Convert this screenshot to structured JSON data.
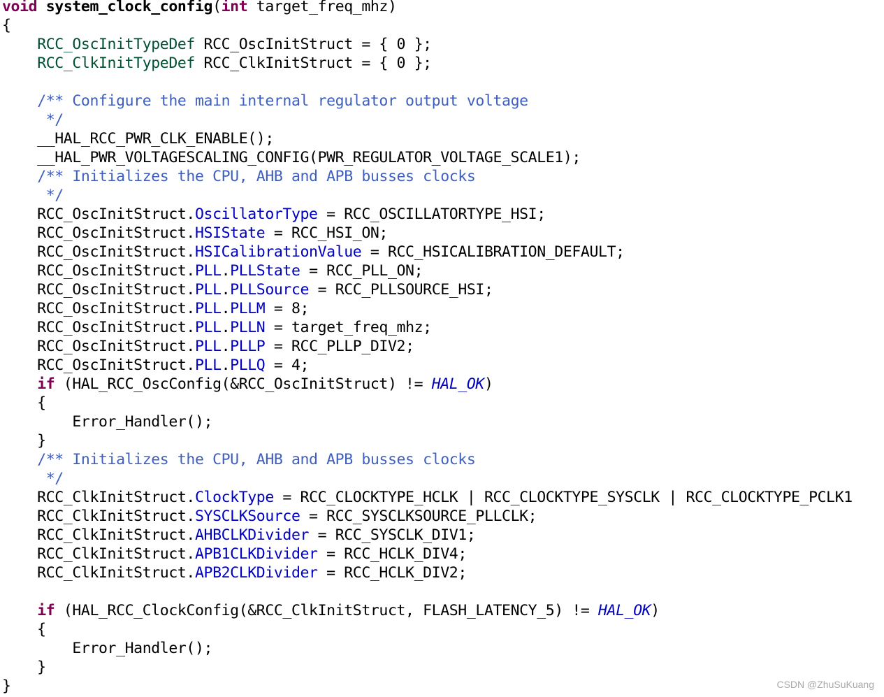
{
  "code": {
    "lines": [
      [
        {
          "t": "void",
          "c": "kw"
        },
        {
          "t": " "
        },
        {
          "t": "system_clock_config",
          "c": "fn"
        },
        {
          "t": "("
        },
        {
          "t": "int",
          "c": "kw"
        },
        {
          "t": " target_freq_mhz)"
        }
      ],
      [
        {
          "t": "{"
        }
      ],
      [
        {
          "t": "    "
        },
        {
          "t": "RCC_OscInitTypeDef",
          "c": "type"
        },
        {
          "t": " RCC_OscInitStruct = { 0 };"
        }
      ],
      [
        {
          "t": "    "
        },
        {
          "t": "RCC_ClkInitTypeDef",
          "c": "type"
        },
        {
          "t": " RCC_ClkInitStruct = { 0 };"
        }
      ],
      [
        {
          "t": ""
        }
      ],
      [
        {
          "t": "    "
        },
        {
          "t": "/** Configure the main internal regulator output voltage",
          "c": "cmt"
        }
      ],
      [
        {
          "t": "     "
        },
        {
          "t": "*/",
          "c": "cmt"
        }
      ],
      [
        {
          "t": "    __HAL_RCC_PWR_CLK_ENABLE();"
        }
      ],
      [
        {
          "t": "    __HAL_PWR_VOLTAGESCALING_CONFIG(PWR_REGULATOR_VOLTAGE_SCALE1);"
        }
      ],
      [
        {
          "t": "    "
        },
        {
          "t": "/** Initializes the CPU, AHB and APB busses clocks",
          "c": "cmt"
        }
      ],
      [
        {
          "t": "     "
        },
        {
          "t": "*/",
          "c": "cmt"
        }
      ],
      [
        {
          "t": "    RCC_OscInitStruct."
        },
        {
          "t": "OscillatorType",
          "c": "field"
        },
        {
          "t": " = RCC_OSCILLATORTYPE_HSI;"
        }
      ],
      [
        {
          "t": "    RCC_OscInitStruct."
        },
        {
          "t": "HSIState",
          "c": "field"
        },
        {
          "t": " = RCC_HSI_ON;"
        }
      ],
      [
        {
          "t": "    RCC_OscInitStruct."
        },
        {
          "t": "HSICalibrationValue",
          "c": "field"
        },
        {
          "t": " = RCC_HSICALIBRATION_DEFAULT;"
        }
      ],
      [
        {
          "t": "    RCC_OscInitStruct."
        },
        {
          "t": "PLL",
          "c": "field"
        },
        {
          "t": "."
        },
        {
          "t": "PLLState",
          "c": "field"
        },
        {
          "t": " = RCC_PLL_ON;"
        }
      ],
      [
        {
          "t": "    RCC_OscInitStruct."
        },
        {
          "t": "PLL",
          "c": "field"
        },
        {
          "t": "."
        },
        {
          "t": "PLLSource",
          "c": "field"
        },
        {
          "t": " = RCC_PLLSOURCE_HSI;"
        }
      ],
      [
        {
          "t": "    RCC_OscInitStruct."
        },
        {
          "t": "PLL",
          "c": "field"
        },
        {
          "t": "."
        },
        {
          "t": "PLLM",
          "c": "field"
        },
        {
          "t": " = 8;"
        }
      ],
      [
        {
          "t": "    RCC_OscInitStruct."
        },
        {
          "t": "PLL",
          "c": "field"
        },
        {
          "t": "."
        },
        {
          "t": "PLLN",
          "c": "field"
        },
        {
          "t": " = target_freq_mhz;"
        }
      ],
      [
        {
          "t": "    RCC_OscInitStruct."
        },
        {
          "t": "PLL",
          "c": "field"
        },
        {
          "t": "."
        },
        {
          "t": "PLLP",
          "c": "field"
        },
        {
          "t": " = RCC_PLLP_DIV2;"
        }
      ],
      [
        {
          "t": "    RCC_OscInitStruct."
        },
        {
          "t": "PLL",
          "c": "field"
        },
        {
          "t": "."
        },
        {
          "t": "PLLQ",
          "c": "field"
        },
        {
          "t": " = 4;"
        }
      ],
      [
        {
          "t": "    "
        },
        {
          "t": "if",
          "c": "kw"
        },
        {
          "t": " (HAL_RCC_OscConfig(&RCC_OscInitStruct) != "
        },
        {
          "t": "HAL_OK",
          "c": "const"
        },
        {
          "t": ")"
        }
      ],
      [
        {
          "t": "    {"
        }
      ],
      [
        {
          "t": "        Error_Handler();"
        }
      ],
      [
        {
          "t": "    }"
        }
      ],
      [
        {
          "t": "    "
        },
        {
          "t": "/** Initializes the CPU, AHB and APB busses clocks",
          "c": "cmt"
        }
      ],
      [
        {
          "t": "     "
        },
        {
          "t": "*/",
          "c": "cmt"
        }
      ],
      [
        {
          "t": "    RCC_ClkInitStruct."
        },
        {
          "t": "ClockType",
          "c": "field"
        },
        {
          "t": " = RCC_CLOCKTYPE_HCLK | RCC_CLOCKTYPE_SYSCLK | RCC_CLOCKTYPE_PCLK1"
        }
      ],
      [
        {
          "t": "    RCC_ClkInitStruct."
        },
        {
          "t": "SYSCLKSource",
          "c": "field"
        },
        {
          "t": " = RCC_SYSCLKSOURCE_PLLCLK;"
        }
      ],
      [
        {
          "t": "    RCC_ClkInitStruct."
        },
        {
          "t": "AHBCLKDivider",
          "c": "field"
        },
        {
          "t": " = RCC_SYSCLK_DIV1;"
        }
      ],
      [
        {
          "t": "    RCC_ClkInitStruct."
        },
        {
          "t": "APB1CLKDivider",
          "c": "field"
        },
        {
          "t": " = RCC_HCLK_DIV4;"
        }
      ],
      [
        {
          "t": "    RCC_ClkInitStruct."
        },
        {
          "t": "APB2CLKDivider",
          "c": "field"
        },
        {
          "t": " = RCC_HCLK_DIV2;"
        }
      ],
      [
        {
          "t": ""
        }
      ],
      [
        {
          "t": "    "
        },
        {
          "t": "if",
          "c": "kw"
        },
        {
          "t": " (HAL_RCC_ClockConfig(&RCC_ClkInitStruct, FLASH_LATENCY_5) != "
        },
        {
          "t": "HAL_OK",
          "c": "const"
        },
        {
          "t": ")"
        }
      ],
      [
        {
          "t": "    {"
        }
      ],
      [
        {
          "t": "        Error_Handler();"
        }
      ],
      [
        {
          "t": "    }"
        }
      ],
      [
        {
          "t": "}"
        }
      ]
    ]
  },
  "colors": {
    "keyword": "#7f0055",
    "type": "#005032",
    "field": "#0000c0",
    "comment": "#3f5fbf",
    "watermark": "#a9a9a9"
  },
  "watermark": "CSDN @ZhuSuKuang"
}
